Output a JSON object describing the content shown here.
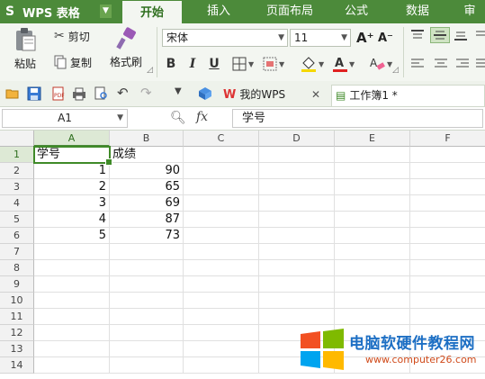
{
  "app": {
    "name": "WPS 表格",
    "logo": "S"
  },
  "ribbon_tabs": [
    {
      "label": "开始",
      "active": true
    },
    {
      "label": "插入",
      "active": false
    },
    {
      "label": "页面布局",
      "active": false
    },
    {
      "label": "公式",
      "active": false
    },
    {
      "label": "数据",
      "active": false
    },
    {
      "label": "审",
      "active": false
    }
  ],
  "clipboard": {
    "paste": "粘贴",
    "cut": "剪切",
    "copy": "复制",
    "format_painter": "格式刷"
  },
  "font": {
    "name": "宋体",
    "size": "11",
    "bold": "B",
    "italic": "I",
    "underline": "U",
    "grow": "A⁺",
    "shrink": "A⁻"
  },
  "quick_access": {
    "wps_tab": "我的WPS",
    "doc_tab": "工作簿1 *"
  },
  "formula_bar": {
    "name_box": "A1",
    "fx": "fx",
    "content": "学号"
  },
  "columns": [
    "A",
    "B",
    "C",
    "D",
    "E",
    "F"
  ],
  "rows": [
    "1",
    "2",
    "3",
    "4",
    "5",
    "6",
    "7",
    "8",
    "9",
    "10",
    "11",
    "12",
    "13",
    "14"
  ],
  "cells": {
    "A1": "学号",
    "B1": "成绩",
    "A2": "1",
    "B2": "90",
    "A3": "2",
    "B3": "65",
    "A4": "3",
    "B4": "69",
    "A5": "4",
    "B5": "87",
    "A6": "5",
    "B6": "73"
  },
  "watermark": {
    "title": "电脑软硬件教程网",
    "url": "www.computer26.com"
  },
  "colors": {
    "accent": "#4c8a3a",
    "selection": "#3f8a28"
  }
}
